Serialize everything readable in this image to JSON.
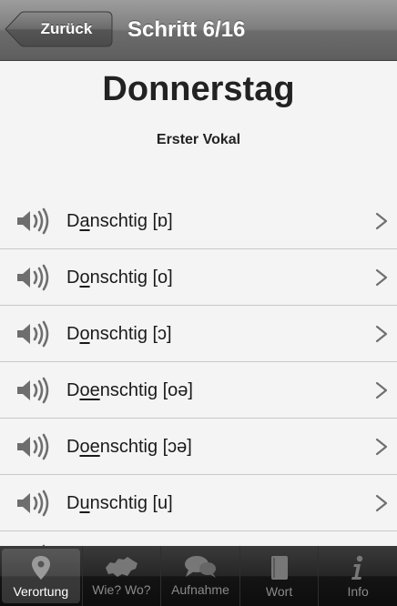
{
  "navbar": {
    "back_label": "Zurück",
    "title": "Schritt 6/16"
  },
  "page": {
    "title": "Donnerstag",
    "subtitle": "Erster Vokal"
  },
  "list": {
    "items": [
      {
        "prefix": "D",
        "vowel": "a",
        "suffix": "nschtig [ɒ]"
      },
      {
        "prefix": "D",
        "vowel": "o",
        "suffix": "nschtig [o]"
      },
      {
        "prefix": "D",
        "vowel": "o",
        "suffix": "nschtig [ɔ]"
      },
      {
        "prefix": "D",
        "vowel": "oe",
        "suffix": "nschtig [oə]"
      },
      {
        "prefix": "D",
        "vowel": "oe",
        "suffix": "nschtig [ɔə]"
      },
      {
        "prefix": "D",
        "vowel": "u",
        "suffix": "nschtig [u]"
      }
    ]
  },
  "tabbar": {
    "tabs": [
      {
        "label": "Verortung",
        "icon": "location-pin-icon",
        "active": true
      },
      {
        "label": "Wie? Wo?",
        "icon": "switzerland-map-icon",
        "active": false
      },
      {
        "label": "Aufnahme",
        "icon": "speech-bubbles-icon",
        "active": false
      },
      {
        "label": "Wort",
        "icon": "book-icon",
        "active": false
      },
      {
        "label": "Info",
        "icon": "info-icon",
        "active": false
      }
    ]
  }
}
